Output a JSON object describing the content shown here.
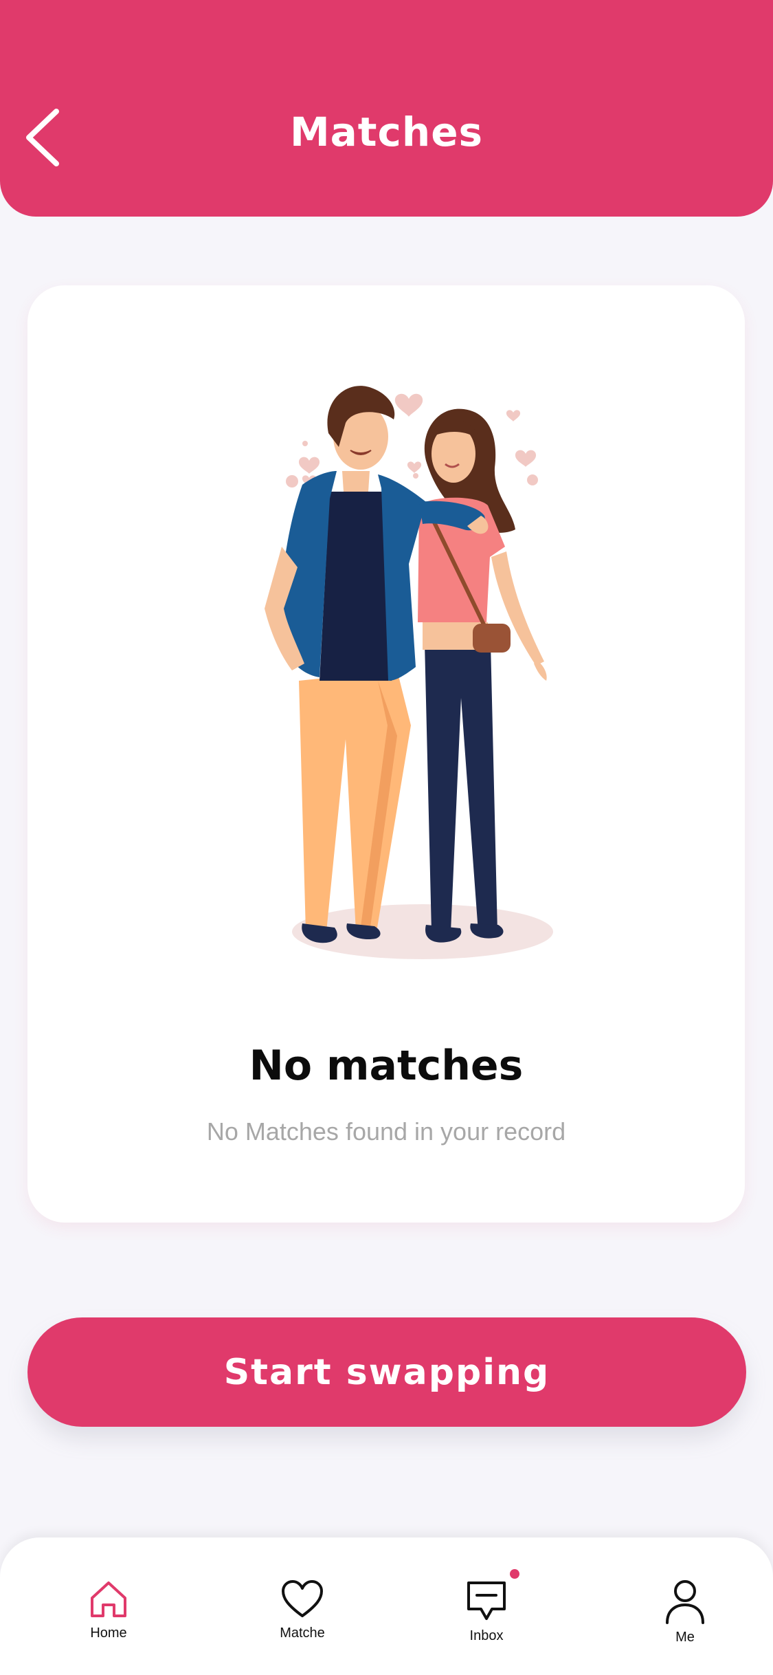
{
  "header": {
    "title": "Matches",
    "back_icon": "chevron-left-icon"
  },
  "empty_state": {
    "title": "No matches",
    "subtitle": "No Matches found in your record",
    "illustration": "couple-illustration"
  },
  "cta": {
    "label": "Start swapping"
  },
  "tabbar": {
    "tabs": [
      {
        "label": "Home",
        "icon": "home-icon",
        "active": true
      },
      {
        "label": "Matche",
        "icon": "heart-icon",
        "active": false
      },
      {
        "label": "Inbox",
        "icon": "chat-icon",
        "active": false,
        "has_notification": true
      },
      {
        "label": "Me",
        "icon": "user-icon",
        "active": false
      }
    ]
  },
  "colors": {
    "accent": "#e03a6b",
    "background": "#f6f5fa",
    "card": "#ffffff",
    "subtitle_text": "#a7a7a7"
  }
}
